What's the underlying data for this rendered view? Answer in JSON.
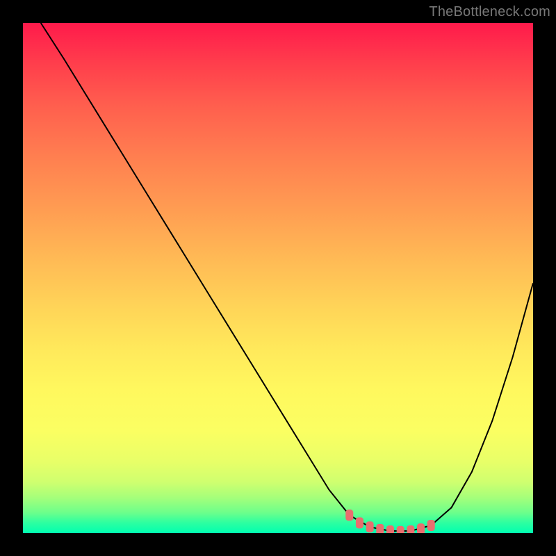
{
  "watermark": "TheBottleneck.com",
  "colors": {
    "background": "#000000",
    "curve_stroke": "#000000",
    "marker_fill": "#e96f6f",
    "gradient_top": "#ff1a4b",
    "gradient_bottom": "#00ffb0"
  },
  "chart_data": {
    "type": "line",
    "title": "",
    "xlabel": "",
    "ylabel": "",
    "xlim": [
      0,
      100
    ],
    "ylim": [
      0,
      100
    ],
    "x": [
      3.5,
      8,
      12,
      16,
      20,
      24,
      28,
      32,
      36,
      40,
      44,
      48,
      52,
      56,
      60,
      64,
      68,
      72,
      76,
      80,
      84,
      88,
      92,
      96,
      100
    ],
    "values": [
      100,
      93,
      86.5,
      80,
      73.5,
      67,
      60.5,
      54,
      47.5,
      41,
      34.5,
      28,
      21.5,
      15,
      8.5,
      3.5,
      1.2,
      0.4,
      0.4,
      1.5,
      5,
      12,
      22,
      34.5,
      49
    ],
    "markers": {
      "x": [
        64,
        66,
        68,
        70,
        72,
        74,
        76,
        78,
        80
      ],
      "y": [
        3.5,
        2.0,
        1.2,
        0.7,
        0.4,
        0.3,
        0.4,
        0.8,
        1.5
      ]
    }
  }
}
